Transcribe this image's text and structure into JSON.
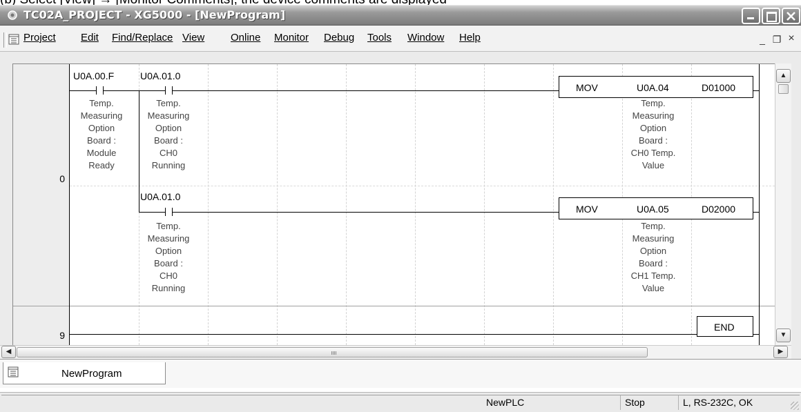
{
  "caption": "(b) Select [View] → [Monitor Comments]; the device comments are displayed",
  "window": {
    "title": "TC02A_PROJECT - XG5000 - [NewProgram]"
  },
  "menu": {
    "items": [
      "Project",
      "Edit",
      "Find/Replace",
      "View",
      "Online",
      "Monitor",
      "Debug",
      "Tools",
      "Window",
      "Help"
    ],
    "mdi_minimize": "_",
    "mdi_restore": "❐",
    "mdi_close": "×"
  },
  "ladder": {
    "rung_numbers": [
      "0",
      "9"
    ],
    "contacts": [
      {
        "device": "U0A.00.F",
        "comment": [
          "Temp.",
          "Measuring",
          "Option",
          "Board :",
          "Module",
          "Ready"
        ]
      },
      {
        "device": "U0A.01.0",
        "comment": [
          "Temp.",
          "Measuring",
          "Option",
          "Board :",
          "CH0",
          "Running"
        ]
      },
      {
        "device": "U0A.01.0",
        "comment": [
          "Temp.",
          "Measuring",
          "Option",
          "Board :",
          "CH0",
          "Running"
        ]
      }
    ],
    "instructions": [
      {
        "op": "MOV",
        "src": "U0A.04",
        "dst": "D01000",
        "comment": [
          "Temp.",
          "Measuring",
          "Option",
          "Board :",
          "CH0 Temp.",
          "Value"
        ]
      },
      {
        "op": "MOV",
        "src": "U0A.05",
        "dst": "D02000",
        "comment": [
          "Temp.",
          "Measuring",
          "Option",
          "Board :",
          "CH1 Temp.",
          "Value"
        ]
      },
      {
        "op": "END"
      }
    ]
  },
  "tab": {
    "label": "NewProgram"
  },
  "status": {
    "plc_name": "NewPLC",
    "mode": "Stop",
    "connection": "L, RS-232C, OK"
  },
  "colors": {
    "titlebar": "#7c7c7c",
    "grid": "#d3d3d3",
    "background": "#ebebeb"
  }
}
